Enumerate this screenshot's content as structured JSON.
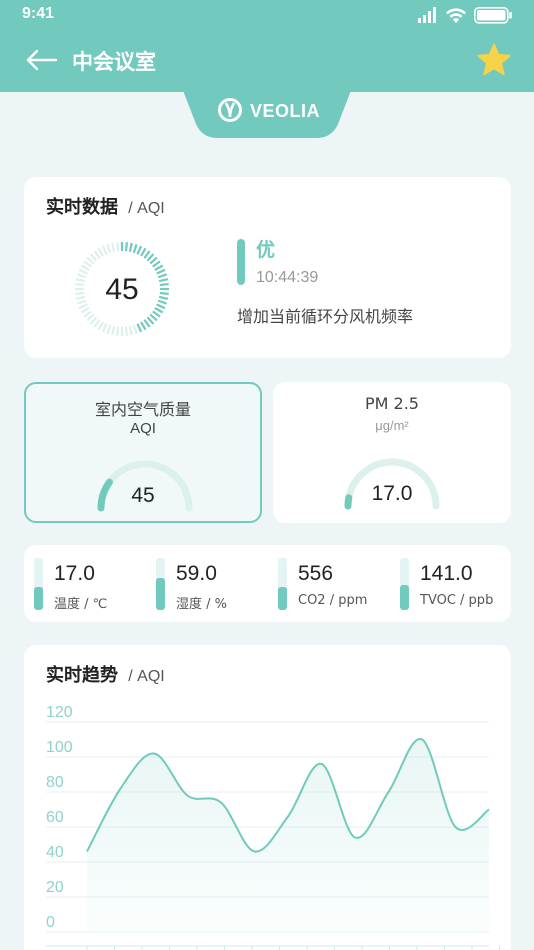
{
  "status": {
    "time": "9:41"
  },
  "nav": {
    "title": "中会议室"
  },
  "brand": {
    "name": "VEOLIA"
  },
  "realtime": {
    "title": "实时数据",
    "subtitle": "/ AQI",
    "aqi_value": "45",
    "aqi_level": 0.45,
    "level": "优",
    "time": "10:44:39",
    "advice": "增加当前循环分风机频率"
  },
  "gauges": [
    {
      "title": "室内空气质量",
      "sub": "AQI",
      "value": "45",
      "level": 0.2
    },
    {
      "title": "PM 2.5",
      "sub": "μg/m²",
      "value": "17.0",
      "level": 0.06
    }
  ],
  "sensors": [
    {
      "value": "17.0",
      "label": "温度 / ℃",
      "level": 0.45
    },
    {
      "value": "59.0",
      "label": "湿度 / %",
      "level": 0.62
    },
    {
      "value": "556",
      "label": "CO2 / ppm",
      "level": 0.45
    },
    {
      "value": "141.0",
      "label": "TVOC / ppb",
      "level": 0.48
    }
  ],
  "trend": {
    "title": "实时趋势",
    "subtitle": "/ AQI"
  },
  "colors": {
    "accent": "#72c9bd",
    "star": "#f7d34a",
    "background": "#eef5f7"
  },
  "chart_data": {
    "type": "area",
    "ylim": [
      0,
      120
    ],
    "yticks": [
      "120",
      "100",
      "80",
      "60",
      "40",
      "20",
      "0"
    ],
    "series": [
      {
        "values": [
          46,
          82,
          102,
          78,
          74,
          46,
          66,
          96,
          54,
          80,
          110,
          60,
          70
        ]
      }
    ]
  }
}
